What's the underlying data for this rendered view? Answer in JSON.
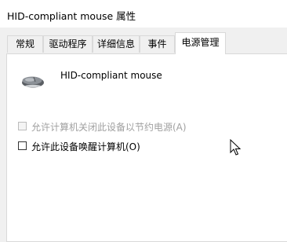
{
  "window": {
    "title": "HID-compliant mouse 属性"
  },
  "tabs": [
    {
      "label": "常规"
    },
    {
      "label": "驱动程序"
    },
    {
      "label": "详细信息"
    },
    {
      "label": "事件"
    },
    {
      "label": "电源管理",
      "active": true
    }
  ],
  "device": {
    "name": "HID-compliant mouse",
    "icon": "mouse-icon"
  },
  "options": [
    {
      "label": "允许计算机关闭此设备以节约电源(A)",
      "checked": false,
      "enabled": false
    },
    {
      "label": "允许此设备唤醒计算机(O)",
      "checked": false,
      "enabled": true
    }
  ]
}
